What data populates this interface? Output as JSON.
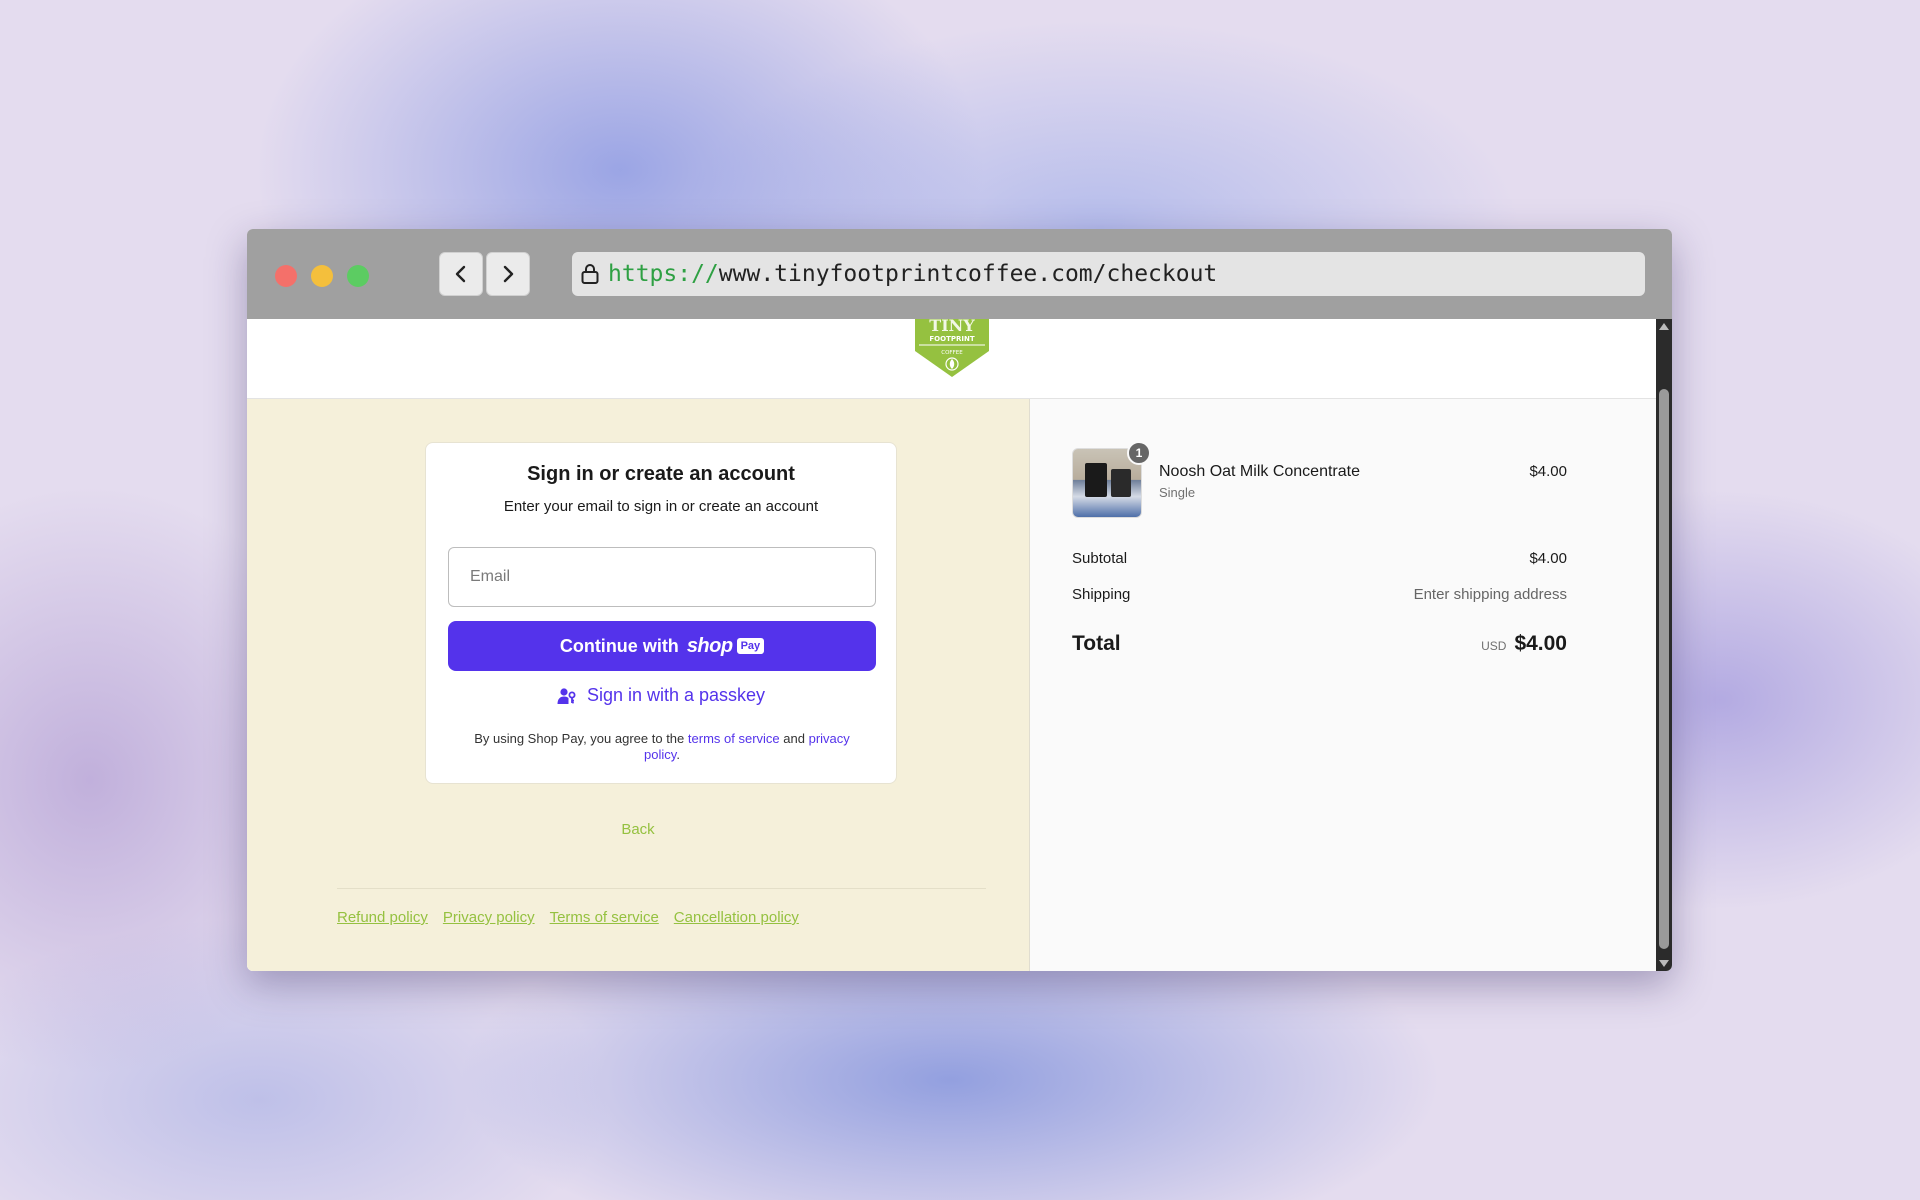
{
  "browser": {
    "url_scheme": "https://",
    "url_rest": "www.tinyfootprintcoffee.com/checkout"
  },
  "header": {
    "logo_text_top": "TINY",
    "logo_text_mid": "FOOTPRINT",
    "logo_text_bottom": "COFFEE"
  },
  "signin": {
    "title": "Sign in or create an account",
    "subtitle": "Enter your email to sign in or create an account",
    "email_placeholder": "Email",
    "continue_label": "Continue with",
    "shop_word": "shop",
    "pay_badge": "Pay",
    "passkey_label": "Sign in with a passkey",
    "legal_prefix": "By using Shop Pay, you agree to the",
    "terms_link": "terms of service",
    "legal_and": "and",
    "privacy_link": "privacy policy",
    "legal_suffix": "."
  },
  "nav": {
    "back_label": "Back"
  },
  "footer": {
    "links": [
      "Refund policy",
      "Privacy policy",
      "Terms of service",
      "Cancellation policy"
    ]
  },
  "order": {
    "item": {
      "quantity": "1",
      "name": "Noosh Oat Milk Concentrate",
      "variant": "Single",
      "price": "$4.00"
    },
    "subtotal_label": "Subtotal",
    "subtotal_value": "$4.00",
    "shipping_label": "Shipping",
    "shipping_value": "Enter shipping address",
    "total_label": "Total",
    "total_currency": "USD",
    "total_value": "$4.00"
  },
  "colors": {
    "brand_green": "#95c140",
    "shop_pay_purple": "#5433eb",
    "left_pane_bg": "#f5f0da"
  }
}
